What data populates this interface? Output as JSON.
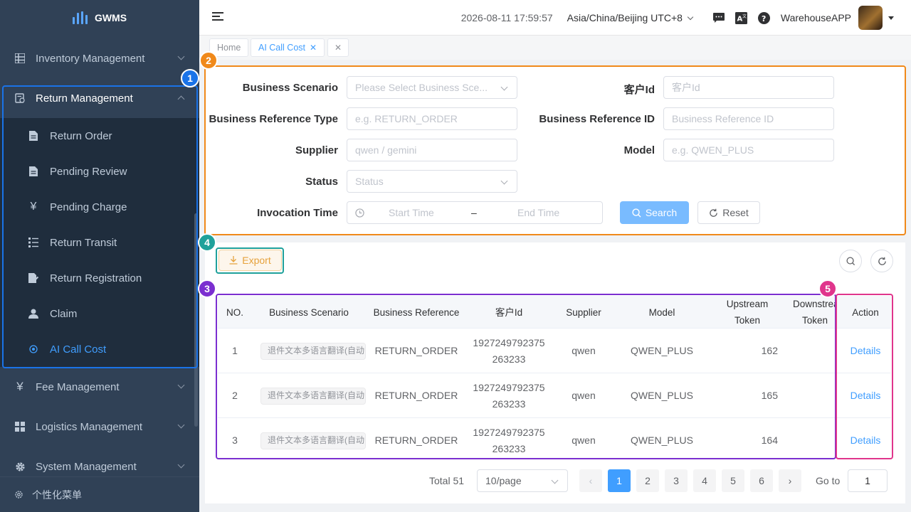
{
  "app": {
    "name": "GWMS"
  },
  "sidebar": {
    "items": [
      {
        "label": "Inventory Management",
        "icon": "grid-icon"
      },
      {
        "label": "Return Management",
        "icon": "return-icon"
      },
      {
        "label": "Fee Management",
        "icon": "yen-icon"
      },
      {
        "label": "Logistics Management",
        "icon": "apps-icon"
      },
      {
        "label": "System Management",
        "icon": "gear-icon"
      }
    ],
    "subitems": [
      {
        "label": "Return Order",
        "icon": "document-icon"
      },
      {
        "label": "Pending Review",
        "icon": "document-icon"
      },
      {
        "label": "Pending Charge",
        "icon": "yen-icon"
      },
      {
        "label": "Return Transit",
        "icon": "list-icon"
      },
      {
        "label": "Return Registration",
        "icon": "edit-document-icon"
      },
      {
        "label": "Claim",
        "icon": "user-icon"
      },
      {
        "label": "AI Call Cost",
        "icon": "target-icon"
      }
    ],
    "footer": "个性化菜单"
  },
  "header": {
    "datetime": "2026-08-11 17:59:57",
    "timezone": "Asia/China/Beijing UTC+8",
    "app_name": "WarehouseAPP"
  },
  "tabs": [
    {
      "label": "Home"
    },
    {
      "label": "AI Call Cost"
    }
  ],
  "annotations": [
    "1",
    "2",
    "3",
    "4",
    "5"
  ],
  "colors": {
    "primary": "#409eff",
    "ann_blue": "#1a73e8",
    "ann_orange": "#f0891a",
    "ann_purple": "#7b2fd0",
    "ann_teal": "#1fa19b",
    "ann_pink": "#e0358c"
  },
  "filters": {
    "business_scenario": {
      "label": "Business Scenario",
      "placeholder": "Please Select Business Sce..."
    },
    "customer_id": {
      "label": "客户Id",
      "placeholder": "客户Id"
    },
    "ref_type": {
      "label": "Business Reference Type",
      "placeholder": "e.g. RETURN_ORDER"
    },
    "ref_id": {
      "label": "Business Reference ID",
      "placeholder": "Business Reference ID"
    },
    "supplier": {
      "label": "Supplier",
      "placeholder": "qwen / gemini"
    },
    "model": {
      "label": "Model",
      "placeholder": "e.g. QWEN_PLUS"
    },
    "status": {
      "label": "Status",
      "placeholder": "Status"
    },
    "invocation_time": {
      "label": "Invocation Time",
      "start": "Start Time",
      "sep": "–",
      "end": "End Time"
    },
    "search": "Search",
    "reset": "Reset"
  },
  "toolbar": {
    "export": "Export"
  },
  "table": {
    "headers": [
      "NO.",
      "Business Scenario",
      "Business Reference",
      "客户Id",
      "Supplier",
      "Model",
      "Upstream Token",
      "Downstream Token",
      "Action"
    ],
    "rows": [
      {
        "no": "1",
        "scenario": "退件文本多语言翻译(自动",
        "reference": "RETURN_ORDER",
        "customer_id": "1927249792375263233",
        "supplier": "qwen",
        "model": "QWEN_PLUS",
        "upstream": "162",
        "action": "Details"
      },
      {
        "no": "2",
        "scenario": "退件文本多语言翻译(自动",
        "reference": "RETURN_ORDER",
        "customer_id": "1927249792375263233",
        "supplier": "qwen",
        "model": "QWEN_PLUS",
        "upstream": "165",
        "action": "Details"
      },
      {
        "no": "3",
        "scenario": "退件文本多语言翻译(自动",
        "reference": "RETURN_ORDER",
        "customer_id": "1927249792375263233",
        "supplier": "qwen",
        "model": "QWEN_PLUS",
        "upstream": "164",
        "action": "Details"
      }
    ]
  },
  "pagination": {
    "total": "Total 51",
    "page_size": "10/page",
    "pages": [
      "1",
      "2",
      "3",
      "4",
      "5",
      "6"
    ],
    "goto_label": "Go to",
    "goto_value": "1"
  }
}
